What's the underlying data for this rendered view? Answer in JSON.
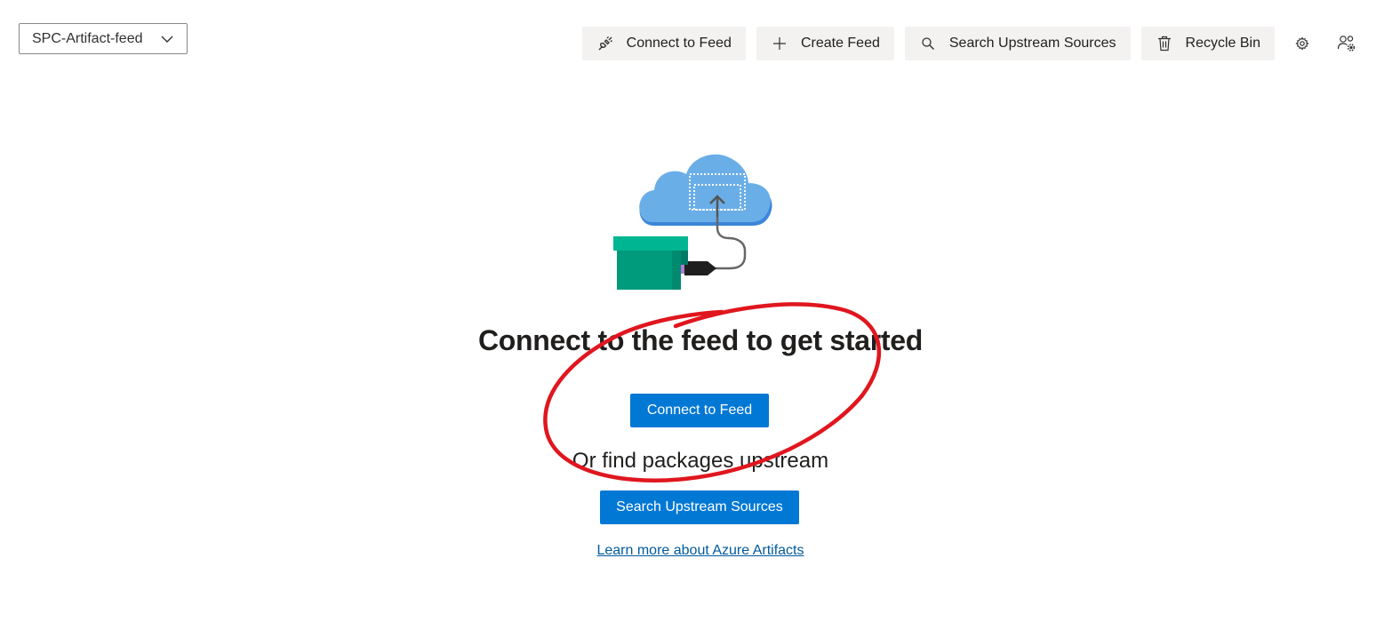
{
  "feed_selector": {
    "value": "SPC-Artifact-feed",
    "icon": "chevron-down-icon"
  },
  "toolbar": {
    "connect_label": "Connect to Feed",
    "create_label": "Create Feed",
    "search_label": "Search Upstream Sources",
    "recycle_label": "Recycle Bin",
    "icons": {
      "connect": "plug-icon",
      "create": "plus-icon",
      "search": "search-icon",
      "recycle": "trash-icon",
      "settings": "gear-icon",
      "permissions": "user-settings-icon"
    }
  },
  "main": {
    "headline": "Connect to the feed to get started",
    "connect_button": "Connect to Feed",
    "subhead": "Or find packages upstream",
    "search_button": "Search Upstream Sources",
    "learn_link": "Learn more about Azure Artifacts"
  },
  "colors": {
    "primary": "#0078d4",
    "link": "#005a9e",
    "toolbar_bg": "#f3f2f1",
    "annotation": "#e0161e",
    "cloud": "#6aa9e6",
    "box": "#00a383"
  }
}
